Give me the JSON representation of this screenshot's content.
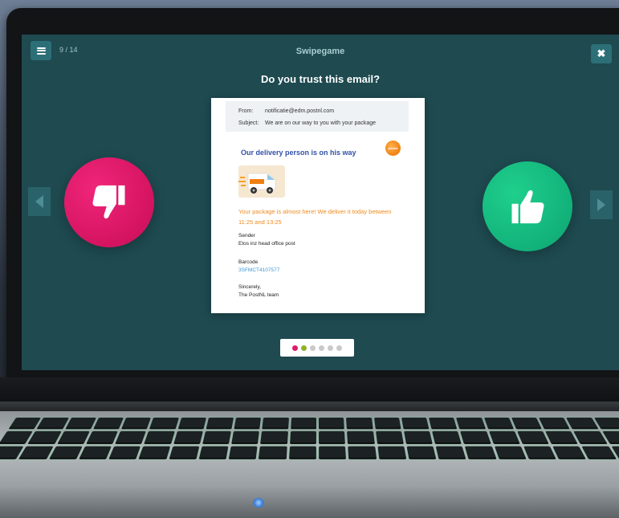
{
  "app": {
    "title": "Swipegame",
    "progress": "9 / 14",
    "question": "Do you trust this email?"
  },
  "icons": {
    "menu": "hamburger-menu-icon",
    "close": "close-icon",
    "prev": "chevron-left-icon",
    "next": "chevron-right-icon",
    "distrust": "thumbs-down-icon",
    "trust": "thumbs-up-icon",
    "close_glyph": "✖"
  },
  "colors": {
    "screen_bg": "#1e4a50",
    "distrust": "#e01a6a",
    "trust": "#16bd80",
    "accent": "#2d6f77",
    "email_heading": "#3350a8",
    "notice": "#f08a1e"
  },
  "email": {
    "from_label": "From:",
    "from_value": "notificatie@edm.postnl.com",
    "subject_label": "Subject:",
    "subject_value": "We are on our way to you with your package",
    "heading": "Our delivery person is on his way",
    "logo_text": "postnl",
    "notice": "Your package is almost here! We deliver it today between 11:25 and 13:25",
    "sender_label": "Sender",
    "sender_value": "Etos inz head office post",
    "barcode_label": "Barcode",
    "barcode_value": "3SFMCT4107577",
    "closing": "Sincerely,",
    "signature": "The PostNL team"
  },
  "pager": {
    "dots": [
      {
        "color": "#e01a6a"
      },
      {
        "color": "#8fb12a"
      },
      {
        "color": "#c9c9c9"
      },
      {
        "color": "#c9c9c9"
      },
      {
        "color": "#c9c9c9"
      },
      {
        "color": "#c9c9c9"
      }
    ]
  }
}
